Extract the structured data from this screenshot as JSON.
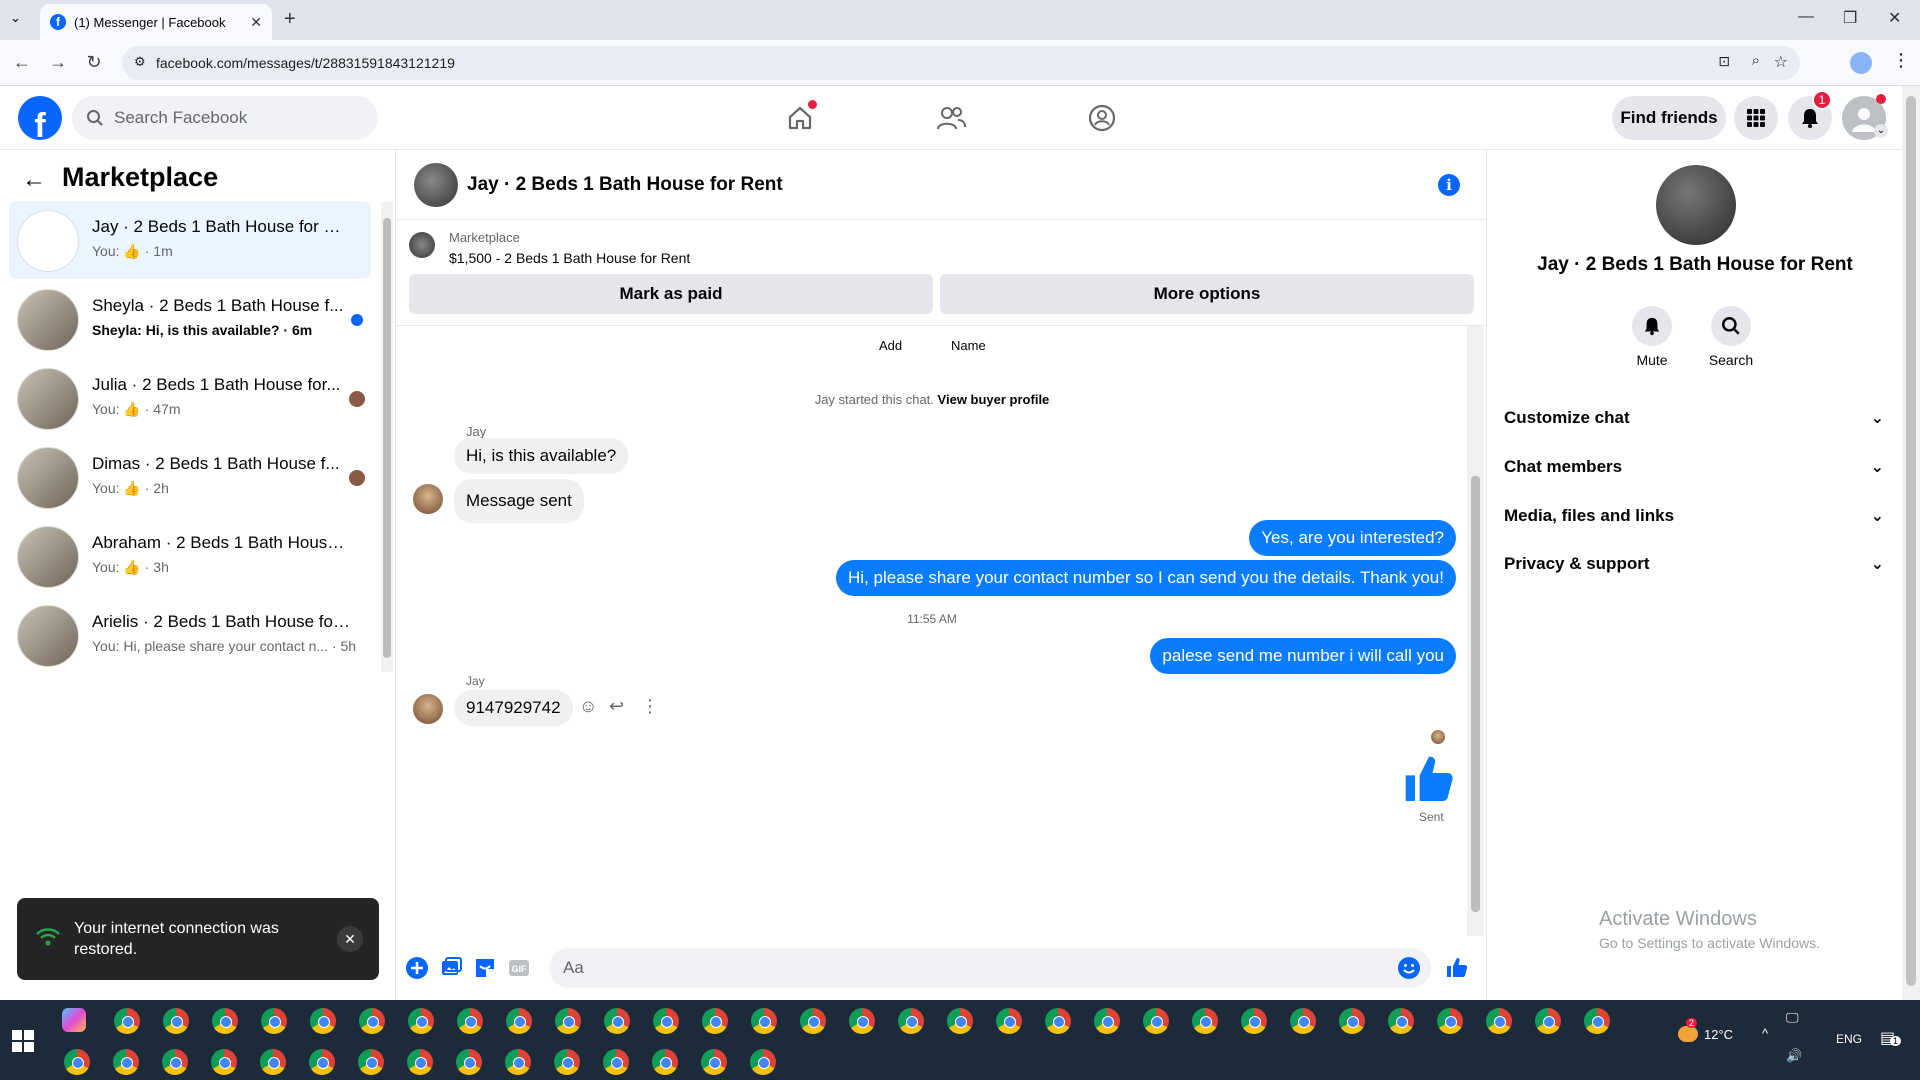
{
  "browser": {
    "tab_title": "(1) Messenger | Facebook",
    "url": "facebook.com/messages/t/28831591843121219"
  },
  "header": {
    "search_placeholder": "Search Facebook",
    "find_friends": "Find friends",
    "notification_count": "1",
    "brand_color": "#0866ff"
  },
  "sidebar": {
    "title": "Marketplace",
    "conversations": [
      {
        "name": "Jay · 2 Beds 1 Bath House for Rent",
        "sub": "You: 👍 · 1m"
      },
      {
        "name": "Sheyla · 2 Beds 1 Bath House f...",
        "sub": "Sheyla: Hi, is this available? · 6m"
      },
      {
        "name": "Julia · 2 Beds 1 Bath House for...",
        "sub": "You: 👍 · 47m"
      },
      {
        "name": "Dimas · 2 Beds 1 Bath House f...",
        "sub": "You: 👍 · 2h"
      },
      {
        "name": "Abraham · 2 Beds 1 Bath House ...",
        "sub": "You: 👍 · 3h"
      },
      {
        "name": "Arielis · 2 Beds 1 Bath House for ...",
        "sub": "You: Hi, please share your contact n... · 5h"
      }
    ]
  },
  "toast": {
    "message": "Your internet connection was restored."
  },
  "chat": {
    "title": "Jay · 2 Beds 1 Bath House for Rent",
    "marketplace_label": "Marketplace",
    "listing": "$1,500 - 2 Beds 1 Bath House for Rent",
    "mark_paid": "Mark as paid",
    "more_options": "More options",
    "add_label": "Add",
    "name_label": "Name",
    "started_text": "Jay started this chat.",
    "view_buyer": "View buyer profile",
    "sender": "Jay",
    "msg_in_1": "Hi, is this available?",
    "msg_in_2": "Message sent",
    "msg_out_1": "Yes, are you interested?",
    "msg_out_2": "Hi, please share your contact number so I can send you the details. Thank you!",
    "time_stamp": "11:55 AM",
    "msg_out_3": "palese send me number i will call you",
    "sender_2": "Jay",
    "msg_in_3": "9147929742",
    "sent_status": "Sent",
    "composer_placeholder": "Aa",
    "bubble_out_color": "#0a7cff"
  },
  "details": {
    "name": "Jay · 2 Beds 1 Bath House for Rent",
    "mute": "Mute",
    "search": "Search",
    "sections": [
      "Customize chat",
      "Chat members",
      "Media, files and links",
      "Privacy & support"
    ]
  },
  "watermark": {
    "line1": "Activate Windows",
    "line2": "Go to Settings to activate Windows."
  },
  "taskbar": {
    "temperature": "12°C",
    "language": "ENG",
    "weather_badge": "2",
    "notification_badge": "1"
  }
}
